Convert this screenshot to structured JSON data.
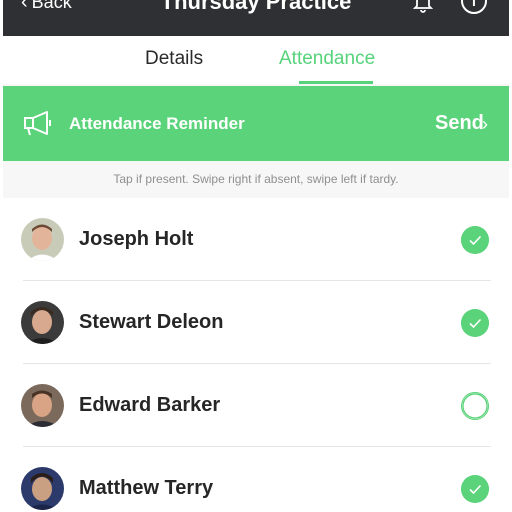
{
  "nav": {
    "back_label": "Back",
    "title": "Thursday Practice"
  },
  "tabs": [
    {
      "label": "Details",
      "active": false
    },
    {
      "label": "Attendance",
      "active": true
    }
  ],
  "reminder": {
    "label": "Attendance Reminder",
    "send_label": "Send"
  },
  "hint": "Tap if present. Swipe right if absent, swipe left if tardy.",
  "players": [
    {
      "name": "Joseph Holt",
      "present": true
    },
    {
      "name": "Stewart Deleon",
      "present": true
    },
    {
      "name": "Edward Barker",
      "present": false
    },
    {
      "name": "Matthew Terry",
      "present": true
    }
  ],
  "colors": {
    "accent": "#5bd37a",
    "navbar": "#2f3033"
  }
}
